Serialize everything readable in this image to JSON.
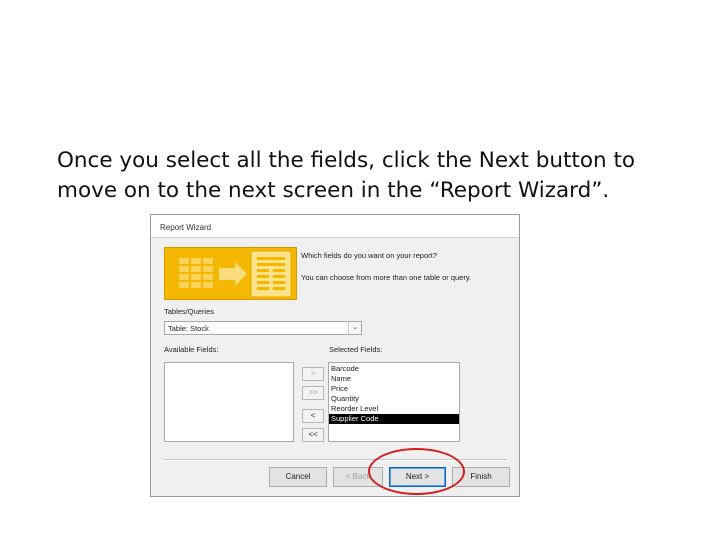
{
  "slide": {
    "caption_line1": "Once you select all the fields, click the Next button to",
    "caption_line2": "move on to the next screen in the “Report Wizard”."
  },
  "wizard": {
    "title": "Report Wizard",
    "prompt_main": "Which fields do you want on your report?",
    "prompt_sub": "You can choose from more than one table or query.",
    "tables_label": "Tables/Queries",
    "tables_value": "Table: Stock",
    "available_label": "Available Fields:",
    "selected_label": "Selected Fields:",
    "available_fields": [],
    "selected_fields": [
      "Barcode",
      "Name",
      "Price",
      "Quantity",
      "Reorder Level",
      "Supplier Code"
    ],
    "selected_highlight": "Supplier Code",
    "move_buttons": {
      "add_one": ">",
      "add_all": ">>",
      "remove_one": "<",
      "remove_all": "<<"
    },
    "buttons": {
      "cancel": "Cancel",
      "back": "< Back",
      "next": "Next >",
      "finish": "Finish"
    }
  },
  "colors": {
    "banner": "#f5b800",
    "highlight_ring": "#d01e1e",
    "selection": "#000000",
    "default_button_border": "#0a64c8"
  },
  "icons": {
    "banner_graphic": "report-wizard-banner-icon",
    "dropdown": "chevron-down-icon"
  }
}
